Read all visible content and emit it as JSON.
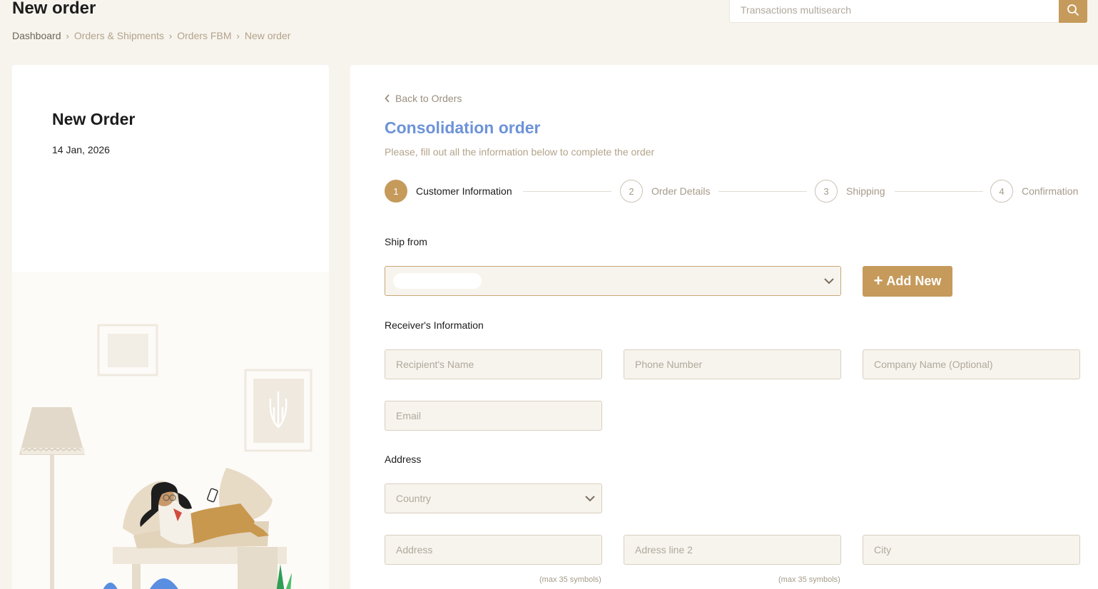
{
  "header": {
    "title": "New order",
    "breadcrumb": [
      "Dashboard",
      "Orders & Shipments",
      "Orders FBM",
      "New order"
    ],
    "search": {
      "placeholder": "Transactions multisearch",
      "icon": "search-icon"
    }
  },
  "sidebar_card": {
    "title": "New Order",
    "date": "14 Jan, 2026"
  },
  "form": {
    "back_label": "Back to Orders",
    "title": "Consolidation order",
    "subtitle": "Please, fill out all the information below to complete the order",
    "steps": [
      {
        "number": "1",
        "label": "Customer Information"
      },
      {
        "number": "2",
        "label": "Order Details"
      },
      {
        "number": "3",
        "label": "Shipping"
      },
      {
        "number": "4",
        "label": "Confirmation"
      }
    ],
    "active_step": 1,
    "ship_from": {
      "label": "Ship from",
      "value": ""
    },
    "add_new_label": "Add New",
    "receiver": {
      "label": "Receiver's Information",
      "recipient_placeholder": "Recipient's Name",
      "phone_placeholder": "Phone Number",
      "company_placeholder": "Company Name (Optional)",
      "email_placeholder": "Email"
    },
    "address": {
      "label": "Address",
      "country_placeholder": "Country",
      "address_placeholder": "Address",
      "address2_placeholder": "Adress line 2",
      "city_placeholder": "City",
      "max_hint": "(max 35 symbols)"
    }
  },
  "colors": {
    "accent": "#c59a5b",
    "title_blue": "#6d93d8",
    "background": "#f7f4ee",
    "field_bg": "#f7f4ee",
    "field_border": "#d9cfbf"
  }
}
